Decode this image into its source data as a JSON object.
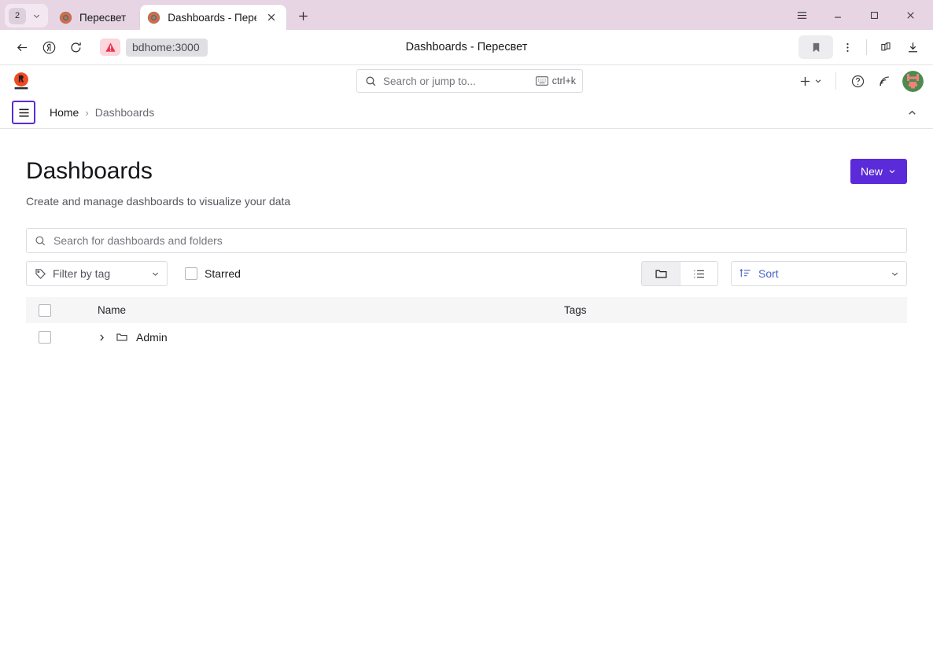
{
  "browser": {
    "tab_group": {
      "count": "2",
      "caret_icon": "chevron-down-icon"
    },
    "tabs": [
      {
        "title": "Пересвет",
        "favicon": "grafana-favicon",
        "active": false
      },
      {
        "title": "Dashboards - Пересвет",
        "favicon": "grafana-favicon",
        "active": true
      }
    ],
    "new_tab_label": "+",
    "window_controls": {
      "menu": "hamburger-icon",
      "minimize": "minimize-icon",
      "maximize": "maximize-icon",
      "close": "close-icon"
    },
    "toolbar": {
      "back_icon": "back-arrow-icon",
      "yandex_icon": "yandex-icon",
      "reload_icon": "reload-icon",
      "security_icon": "warning-triangle-icon",
      "url": "bdhome:3000",
      "page_title": "Dashboards - Пересвет",
      "bookmark_icon": "bookmark-icon",
      "menu_icon": "more-vertical-icon",
      "extensions_icon": "extensions-icon",
      "downloads_icon": "download-icon"
    }
  },
  "grafana": {
    "logo": "grafana-logo",
    "search": {
      "placeholder": "Search or jump to...",
      "shortcut": "ctrl+k",
      "keyboard_icon": "keyboard-icon",
      "search_icon": "search-icon"
    },
    "topbar_actions": {
      "new_icon": "plus-icon",
      "new_caret": "chevron-down-icon",
      "help_icon": "help-circle-icon",
      "news_icon": "rss-feed-icon",
      "avatar": "user-avatar"
    },
    "breadcrumb": {
      "menu_icon": "hamburger-menu-icon",
      "home": "Home",
      "separator": "›",
      "current": "Dashboards",
      "collapse_icon": "chevron-up-icon"
    },
    "page": {
      "title": "Dashboards",
      "subtitle": "Create and manage dashboards to visualize your data",
      "new_button": "New",
      "new_button_caret": "chevron-down-icon",
      "new_button_color": "#5b2bd9"
    },
    "search_box": {
      "placeholder": "Search for dashboards and folders",
      "icon": "search-icon"
    },
    "filters": {
      "tag_filter_label": "Filter by tag",
      "tag_filter_icon": "tag-icon",
      "tag_filter_caret": "chevron-down-icon",
      "starred_label": "Starred",
      "starred_checked": false,
      "view_folder_icon": "folder-icon",
      "view_list_icon": "list-icon",
      "view_active": "folder",
      "sort_label": "Sort",
      "sort_icon": "sort-amount-icon",
      "sort_caret": "chevron-down-icon"
    },
    "table": {
      "columns": [
        "Name",
        "Tags"
      ],
      "rows": [
        {
          "name": "Admin",
          "icon": "folder-icon",
          "expander": "chevron-right-icon",
          "tags": "",
          "checked": false
        }
      ]
    }
  }
}
